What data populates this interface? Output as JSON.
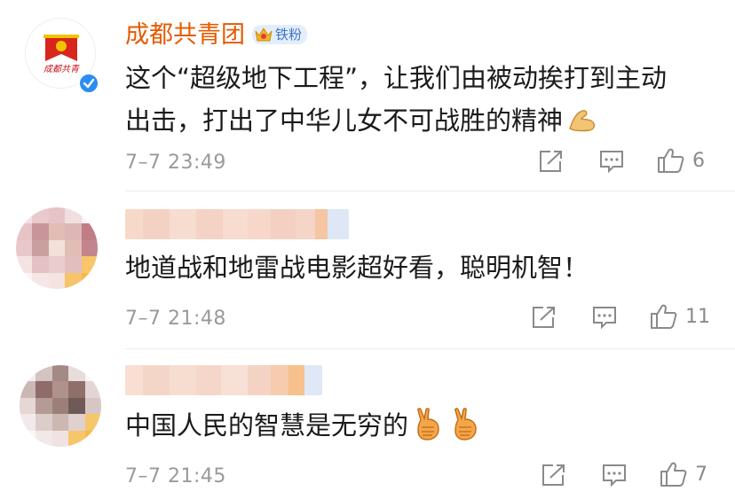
{
  "comments": [
    {
      "author": "成都共青团",
      "badge_label": "铁粉",
      "verified": true,
      "text_line1": "这个“超级地下工程”，让我们由被动挨打到主动",
      "text_line2": "出击，打出了中华儿女不可战胜的精神",
      "emoji": [
        "flexed-biceps"
      ],
      "time": "7–7  23:49",
      "likes": "6"
    },
    {
      "author_obscured": true,
      "text": "地道战和地雷战电影超好看，聪明机智！",
      "time": "7–7  21:48",
      "likes": "11"
    },
    {
      "author_obscured": true,
      "text": "中国人民的智慧是无穷的",
      "emoji": [
        "victory-hand",
        "victory-hand"
      ],
      "time": "7–7  21:45",
      "likes": "7"
    }
  ],
  "colors": {
    "author": "#e65a00",
    "meta": "#9a9a9a",
    "divider": "#ececec",
    "badge_bg": "#e4eefb",
    "badge_text": "#3e74c6"
  }
}
